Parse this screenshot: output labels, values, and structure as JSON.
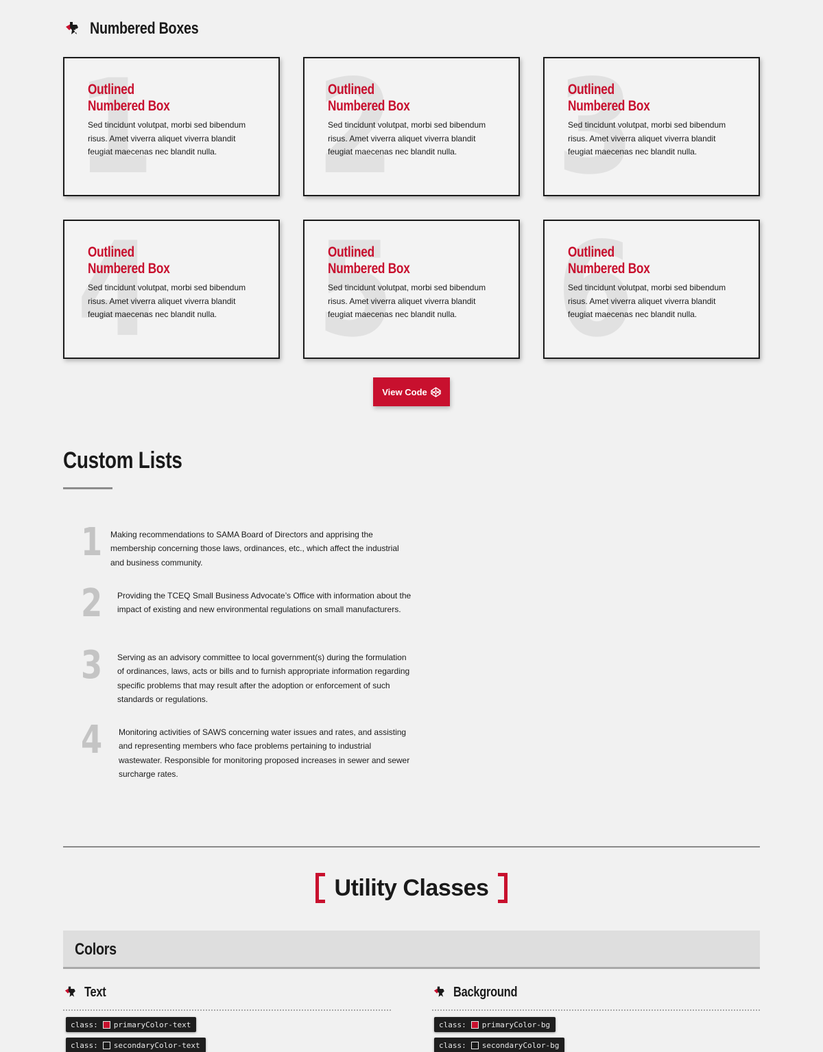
{
  "numbered_boxes": {
    "title": "Numbered Boxes",
    "boxes": [
      {
        "number": "1",
        "title_line1": "Outlined",
        "title_line2": "Numbered Box",
        "body": "Sed tincidunt volutpat, morbi sed bibendum risus. Amet viverra aliquet viverra blandit feugiat maecenas nec blandit nulla."
      },
      {
        "number": "2",
        "title_line1": "Outlined",
        "title_line2": "Numbered Box",
        "body": "Sed tincidunt volutpat, morbi sed bibendum risus. Amet viverra aliquet viverra blandit feugiat maecenas nec blandit nulla."
      },
      {
        "number": "3",
        "title_line1": "Outlined",
        "title_line2": "Numbered Box",
        "body": "Sed tincidunt volutpat, morbi sed bibendum risus. Amet viverra aliquet viverra blandit feugiat maecenas nec blandit nulla."
      },
      {
        "number": "4",
        "title_line1": "Outlined",
        "title_line2": "Numbered Box",
        "body": "Sed tincidunt volutpat, morbi sed bibendum risus. Amet viverra aliquet viverra blandit feugiat maecenas nec blandit nulla."
      },
      {
        "number": "5",
        "title_line1": "Outlined",
        "title_line2": "Numbered Box",
        "body": "Sed tincidunt volutpat, morbi sed bibendum risus. Amet viverra aliquet viverra blandit feugiat maecenas nec blandit nulla."
      },
      {
        "number": "6",
        "title_line1": "Outlined",
        "title_line2": "Numbered Box",
        "body": "Sed tincidunt volutpat, morbi sed bibendum risus. Amet viverra aliquet viverra blandit feugiat maecenas nec blandit nulla."
      }
    ],
    "view_code_label": "View Code",
    "view_code_icon": "codepen-icon"
  },
  "custom_lists": {
    "title": "Custom Lists",
    "items": [
      {
        "number": "1",
        "text": "Making recommendations to SAMA Board of Directors and apprising the membership concerning those laws, ordinances, etc., which affect the industrial and business community."
      },
      {
        "number": "2",
        "text": "Providing the TCEQ Small Business Advocate’s Office with information about the impact of existing and new environmental regulations on small manufacturers."
      },
      {
        "number": "3",
        "text": "Serving as an advisory committee to local government(s) during the formulation of ordinances, laws, acts or bills and to furnish appropriate information regarding specific problems that may result after the adoption or enforcement of such standards or regulations."
      },
      {
        "number": "4",
        "text": "Monitoring activities of SAWS concerning water issues and rates, and assisting and representing members who face problems pertaining to industrial wastewater. Responsible for monitoring proposed increases in sewer and sewer surcharge rates."
      }
    ]
  },
  "utility_classes": {
    "title": "Utility Classes",
    "colors": {
      "title": "Colors",
      "text": {
        "title": "Text",
        "rows": [
          {
            "prefix": "class:",
            "name": "primaryColor-text",
            "swatch": "#c8102e"
          },
          {
            "prefix": "class:",
            "name": "secondaryColor-text",
            "swatch": "#1a1a1a"
          }
        ]
      },
      "background": {
        "title": "Background",
        "rows": [
          {
            "prefix": "class:",
            "name": "primaryColor-bg",
            "swatch": "#c8102e"
          },
          {
            "prefix": "class:",
            "name": "secondaryColor-bg",
            "swatch": "#1a1a1a"
          }
        ]
      }
    }
  },
  "theme": {
    "primary": "#c8102e",
    "secondary": "#1a1a1a",
    "background": "#f1f1f1"
  }
}
